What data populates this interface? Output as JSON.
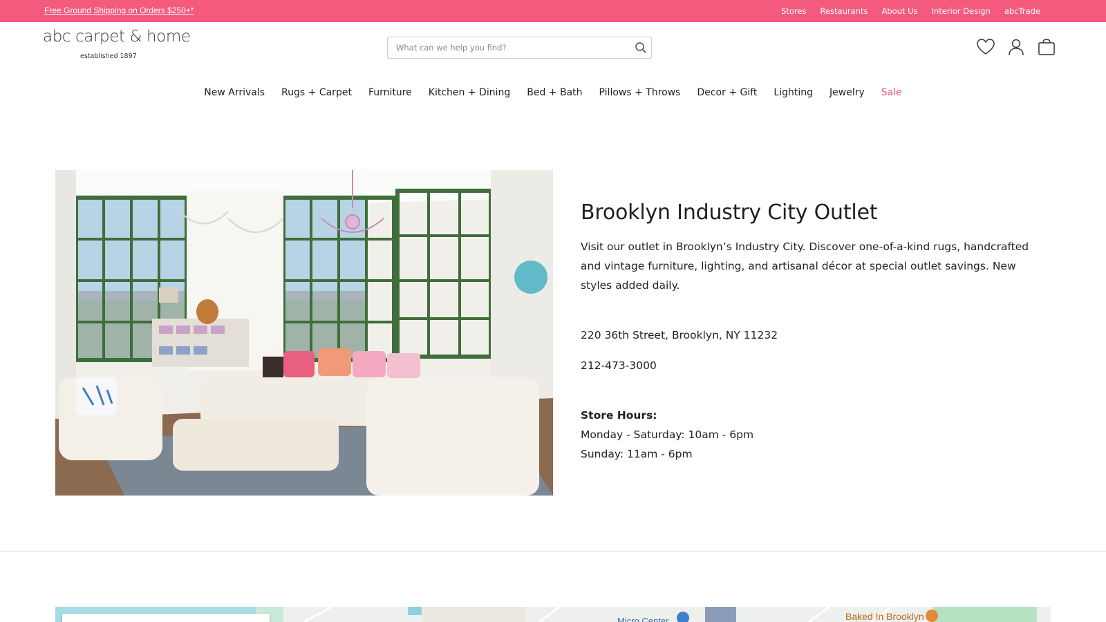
{
  "promo": {
    "text": "Free Ground Shipping on Orders $250+*"
  },
  "utility_nav": [
    "Stores",
    "Restaurants",
    "About Us",
    "Interior Design",
    "abcTrade"
  ],
  "logo": {
    "name": "abc carpet & home",
    "tagline": "established 1897"
  },
  "search": {
    "placeholder": "What can we help you find?"
  },
  "header_icons": [
    "heart-icon",
    "user-icon",
    "bag-icon"
  ],
  "main_nav": [
    "New Arrivals",
    "Rugs + Carpet",
    "Furniture",
    "Kitchen + Dining",
    "Bed + Bath",
    "Pillows + Throws",
    "Decor + Gift",
    "Lighting",
    "Jewelry",
    "Sale"
  ],
  "colors": {
    "brand_pink": "#f45a7e",
    "sale": "#e8557a"
  },
  "store": {
    "title": "Brooklyn Industry City Outlet",
    "description": "Visit our outlet in Brooklyn’s Industry City. Discover one-of-a-kind rugs, handcrafted and vintage furniture, lighting, and artisanal décor at special outlet savings. New styles added daily.",
    "address": "220 36th Street, Brooklyn, NY 11232",
    "phone": "212-473-3000",
    "hours_label": "Store Hours:",
    "hours": [
      "Monday - Saturday: 10am - 6pm",
      "Sunday: 11am - 6pm"
    ]
  },
  "map": {
    "labels": [
      "Micro Center",
      "Baked In Brooklyn"
    ]
  }
}
